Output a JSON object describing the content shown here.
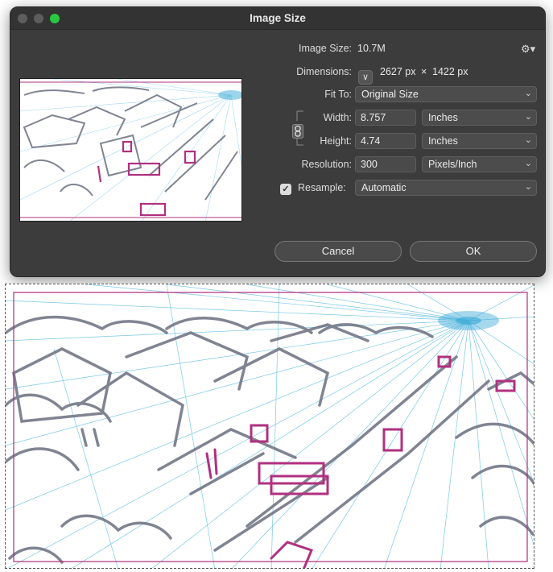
{
  "window": {
    "title": "Image Size"
  },
  "image_size": {
    "label": "Image Size:",
    "value": "10.7M"
  },
  "dimensions": {
    "label": "Dimensions:",
    "width_value": "2627 px",
    "times": "×",
    "height_value": "1422 px"
  },
  "fit_to": {
    "label": "Fit To:",
    "value": "Original Size"
  },
  "width": {
    "label": "Width:",
    "value": "8.757",
    "unit": "Inches"
  },
  "height": {
    "label": "Height:",
    "value": "4.74",
    "unit": "Inches"
  },
  "resolution": {
    "label": "Resolution:",
    "value": "300",
    "unit": "Pixels/Inch"
  },
  "resample": {
    "label": "Resample:",
    "value": "Automatic",
    "checked": true
  },
  "buttons": {
    "cancel": "Cancel",
    "ok": "OK"
  },
  "icons": {
    "gear": "gear-icon",
    "chain": "link-chain-icon",
    "chevron": "chevron-down-icon",
    "checkmark": "checkmark-icon"
  },
  "colors": {
    "dialog_bg": "#3c3c3c",
    "sketch_pink": "#b0307f",
    "sketch_blue": "#39a9d6",
    "sketch_gray": "#6b6f80"
  }
}
